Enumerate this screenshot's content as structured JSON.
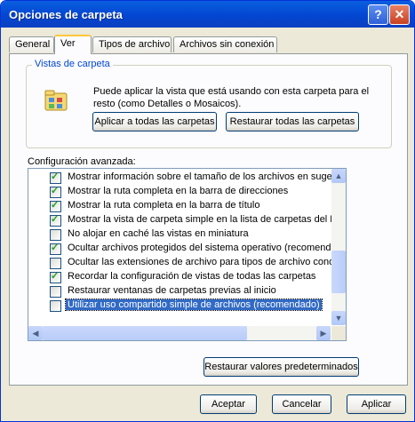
{
  "window": {
    "title": "Opciones de carpeta"
  },
  "tabs": [
    "General",
    "Ver",
    "Tipos de archivo",
    "Archivos sin conexión"
  ],
  "views": {
    "legend": "Vistas de carpeta",
    "description": "Puede aplicar la vista que está usando con esta carpeta para el resto (como Detalles o Mosaicos).",
    "apply_all": "Aplicar a todas las carpetas",
    "reset_all": "Restaurar todas las carpetas"
  },
  "advanced": {
    "label": "Configuración avanzada:",
    "items": [
      {
        "text": "Mostrar información sobre el tamaño de los archivos en sugerencia",
        "checked": true
      },
      {
        "text": "Mostrar la ruta completa en la barra de direcciones",
        "checked": true
      },
      {
        "text": "Mostrar la ruta completa en la barra de título",
        "checked": true
      },
      {
        "text": "Mostrar la vista de carpeta simple en la lista de carpetas del Explor",
        "checked": true
      },
      {
        "text": "No alojar en caché las vistas en miniatura",
        "checked": false
      },
      {
        "text": "Ocultar archivos protegidos del sistema operativo (recomendado)",
        "checked": true
      },
      {
        "text": "Ocultar las extensiones de archivo para tipos de archivo conocido",
        "checked": false
      },
      {
        "text": "Recordar la configuración de vistas de todas las carpetas",
        "checked": true
      },
      {
        "text": "Restaurar ventanas de carpetas previas al inicio",
        "checked": false
      },
      {
        "text": "Utilizar uso compartido simple de archivos (recomendado)",
        "checked": false,
        "selected": true
      }
    ]
  },
  "restore_defaults": "Restaurar valores predeterminados",
  "footer": {
    "ok": "Aceptar",
    "cancel": "Cancelar",
    "apply": "Aplicar"
  }
}
